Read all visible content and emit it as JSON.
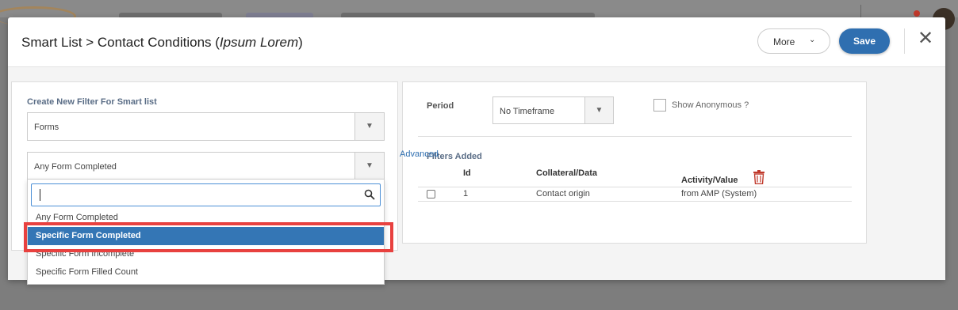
{
  "modal": {
    "title_prefix": "Smart List > Contact Conditions (",
    "title_italic": "Ipsum Lorem",
    "title_suffix": ")",
    "more_label": "More",
    "save_label": "Save"
  },
  "left_panel": {
    "heading": "Create New Filter For Smart list",
    "filter_type_value": "Forms",
    "condition_value": "Any Form Completed"
  },
  "dropdown": {
    "search_value": "",
    "options": [
      "Any Form Completed",
      "Specific Form Completed",
      "Specific Form Incomplete",
      "Specific Form Filled Count"
    ],
    "highlighted": "Specific Form Completed"
  },
  "right_panel": {
    "period_label": "Period",
    "period_value": "No Timeframe",
    "anonymous_label": "Show Anonymous ?",
    "filters_added_label": "Filters Added",
    "columns": [
      "Id",
      "Collateral/Data",
      "Activity/Value"
    ],
    "rows": [
      {
        "id": "1",
        "collateral": "Contact origin",
        "activity": "from AMP (System)"
      }
    ]
  },
  "advanced_label": "Advanced",
  "colors": {
    "primary": "#2f6fb0",
    "highlight": "#3476b5",
    "annotation": "#e8413f",
    "trash": "#c0392b"
  }
}
